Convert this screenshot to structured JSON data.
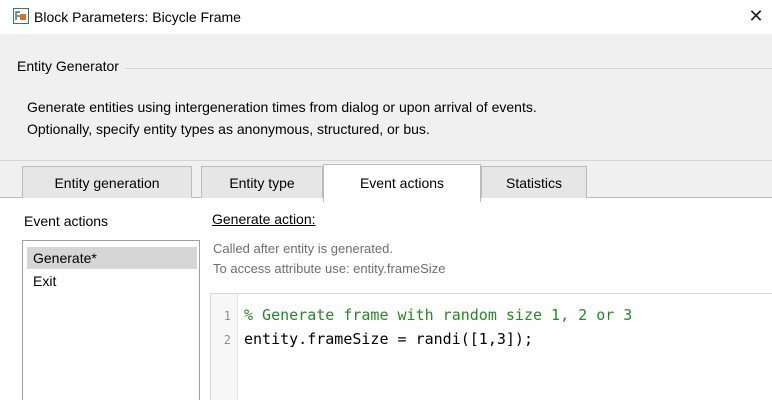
{
  "window": {
    "title": "Block Parameters: Bicycle Frame",
    "close_glyph": "✕"
  },
  "block": {
    "type_title": "Entity Generator",
    "description_line1": "Generate entities using intergeneration times from dialog or upon arrival of events.",
    "description_line2": "Optionally, specify entity types as anonymous, structured, or bus."
  },
  "tabs": [
    {
      "label": "Entity generation",
      "active": false
    },
    {
      "label": "Entity type",
      "active": false
    },
    {
      "label": "Event actions",
      "active": true
    },
    {
      "label": "Statistics",
      "active": false
    }
  ],
  "event_actions": {
    "list_title": "Event actions",
    "items": [
      {
        "label": "Generate*",
        "selected": true
      },
      {
        "label": "Exit",
        "selected": false
      }
    ]
  },
  "action": {
    "title": "Generate action:",
    "hint_line1": "Called after entity is generated.",
    "hint_line2": "To access attribute use: entity.frameSize"
  },
  "editor": {
    "lines": [
      {
        "number": "1",
        "text": "% Generate frame with random size 1, 2 or 3"
      },
      {
        "number": "2",
        "text": "entity.frameSize = randi([1,3]);"
      }
    ]
  },
  "icons": {
    "app": "simulink-block-icon",
    "close": "close-icon"
  },
  "colors": {
    "comment": "#228b22",
    "selection": "#d6d6d6",
    "background": "#f0f0f0"
  }
}
